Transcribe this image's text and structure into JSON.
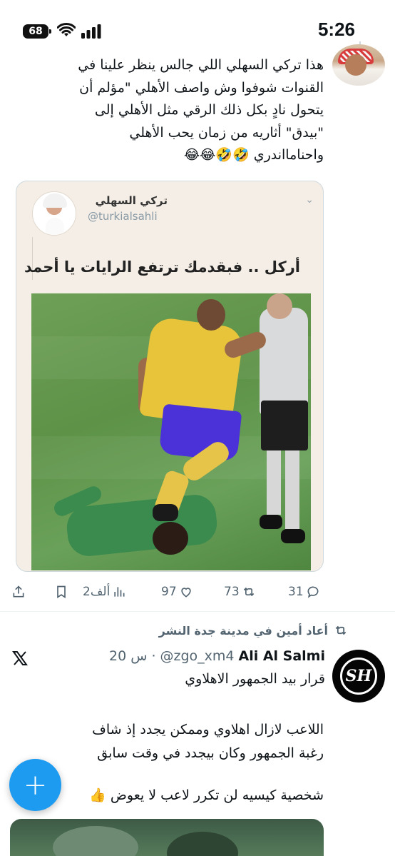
{
  "status_bar": {
    "battery": "68",
    "time": "5:26"
  },
  "tweet1": {
    "text_lines": [
      "هذا تركي السهلي اللي جالس ينظر علينا في",
      "القنوات شوفوا وش واصف الأهلي \"مؤلم أن",
      "يتحول نادٍ بكل ذلك الرقي مثل الأهلي إلى",
      "\"بيدق\" أثاريه من زمان يحب الأهلي",
      "واحنامااندري 🤣🤣😂😂"
    ],
    "quoted": {
      "name": "تركي السهلي",
      "handle": "@turkialsahli",
      "text": "أركل .. فبقدمك ترتفع الرايات يا أحمد"
    },
    "actions": {
      "views": "2ألف",
      "likes": "97",
      "retweets": "73",
      "replies": "31"
    }
  },
  "tweet2": {
    "retweeted_by": "أعاد أمين  في مدينة جدة النشر",
    "name": "Ali Al Salmi",
    "handle": "@zgo_xm4",
    "separator": "·",
    "time": "20 س",
    "line1": "قرار بيد الجمهور الاهلاوي",
    "body_lines": [
      "اللاعب لازال اهلاوي وممكن يجدد إذ شاف",
      "رغبة الجمهور وكان بيجدد في وقت سابق"
    ],
    "body2": "شخصية كيسيه لن تكرر لاعب لا يعوض 👍",
    "avatar_text": "SH"
  },
  "fab": {
    "label": "+"
  },
  "colors": {
    "accent": "#1d9bf0",
    "muted": "#536471",
    "text": "#0f1419"
  },
  "icons": [
    "battery-icon",
    "wifi-icon",
    "signal-icon",
    "share-icon",
    "bookmark-icon",
    "views-icon",
    "like-icon",
    "retweet-icon",
    "reply-icon",
    "x-logo-icon",
    "plus-icon"
  ]
}
